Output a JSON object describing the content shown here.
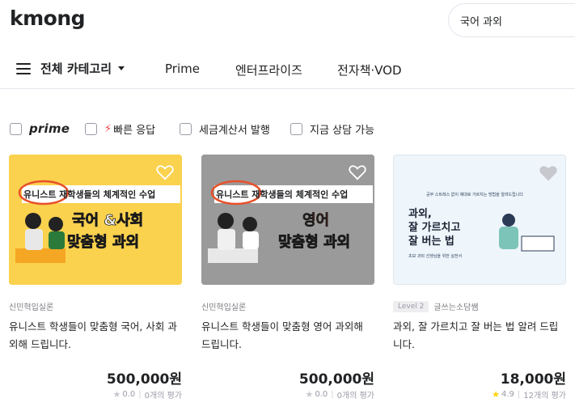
{
  "header": {
    "logo": "kmong",
    "search_value": "국어 과외"
  },
  "nav": {
    "category_label": "전체 카테고리",
    "links": [
      "Prime",
      "엔터프라이즈",
      "전자책·VOD"
    ]
  },
  "filters": {
    "prime": "prime",
    "fast": "빠른 응답",
    "tax": "세금계산서 발행",
    "consult": "지금 상담 가능"
  },
  "cards": [
    {
      "banner": "유니스트 재학생들의 체계적인 수업",
      "banner_highlight": "유니스트",
      "headline1": "국어 &사회",
      "headline2": "맞춤형 과외",
      "seller": "신민혁입실론",
      "title": "유니스트 학생들이 맞춤형 국어, 사회 과외해 드립니다.",
      "price": "500,000원",
      "rating": "0.0",
      "reviews": "0개의 평가",
      "bg": "#fbd24e"
    },
    {
      "banner": "유니스트 재학생들의 체계적인 수업",
      "banner_highlight": "유니스트",
      "headline1": "영어",
      "headline2": "맞춤형 과외",
      "seller": "신민혁입실론",
      "title": "유니스트 학생들이 맞춤형 영어 과외해 드립니다.",
      "price": "500,000원",
      "rating": "0.0",
      "reviews": "0개의 평가",
      "bg": "#9a9a9a"
    },
    {
      "top_text": "공부 스트레스 없이 제대로 가르치는 방법을 알려드립니다",
      "headline1": "과외,",
      "headline2": "잘 가르치고",
      "headline3": "잘 버는 법",
      "sub_text": "초보 과외 선생님을 위한 실전서",
      "level": "Level 2",
      "seller": "글쓰는소담쌤",
      "title": "과외, 잘 가르치고 잘 버는 법 알려 드립니다.",
      "price": "18,000원",
      "rating": "4.9",
      "reviews": "12개의 평가",
      "bg": "#e8f3fb"
    }
  ],
  "colors": {
    "accent_star": "#ffd400",
    "star_empty": "#c7c8ce",
    "bolt": "#f23f3f",
    "highlight_ring": "#e8502a",
    "red_text": "#e8402a"
  }
}
